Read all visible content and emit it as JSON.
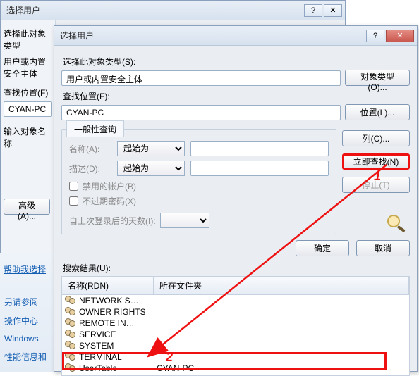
{
  "back_dialog": {
    "title": "选择用户",
    "labels": {
      "select_type": "选择此对象类型",
      "principal": "用户或内置安全主体",
      "find_in": "查找位置(F)",
      "location_value": "CYAN-PC",
      "enter_name": "输入对象名称"
    },
    "buttons": {
      "advanced": "高级(A)..."
    },
    "help_link": "帮助我选择"
  },
  "side_links": {
    "see_also": "另请参阅",
    "action_center": "操作中心",
    "windows": "Windows",
    "perf_info": "性能信息和"
  },
  "front_dialog": {
    "title": "选择用户",
    "labels": {
      "select_type": "选择此对象类型(S):",
      "principal_value": "用户或内置安全主体",
      "find_in": "查找位置(F):",
      "location_value": "CYAN-PC",
      "common_query_tab": "一般性查询",
      "name": "名称(A):",
      "description": "描述(D):",
      "starts_with": "起始为",
      "disabled_accounts": "禁用的帐户(B)",
      "non_expiring": "不过期密码(X)",
      "days_since_logon": "自上次登录后的天数(I):",
      "search_results": "搜索结果(U):",
      "col_rdn": "名称(RDN)",
      "col_folder": "所在文件夹"
    },
    "buttons": {
      "object_types": "对象类型(O)...",
      "locations": "位置(L)...",
      "columns": "列(C)...",
      "find_now": "立即查找(N)",
      "stop": "停止(T)",
      "ok": "确定",
      "cancel": "取消"
    },
    "results": [
      {
        "rdn": "NETWORK S…",
        "folder": ""
      },
      {
        "rdn": "OWNER RIGHTS",
        "folder": ""
      },
      {
        "rdn": "REMOTE IN…",
        "folder": ""
      },
      {
        "rdn": "SERVICE",
        "folder": ""
      },
      {
        "rdn": "SYSTEM",
        "folder": ""
      },
      {
        "rdn": "TERMINAL",
        "folder": ""
      },
      {
        "rdn": "UserTable",
        "folder": "CYAN-PC"
      }
    ]
  },
  "annotations": {
    "one": "1",
    "two": "2"
  }
}
